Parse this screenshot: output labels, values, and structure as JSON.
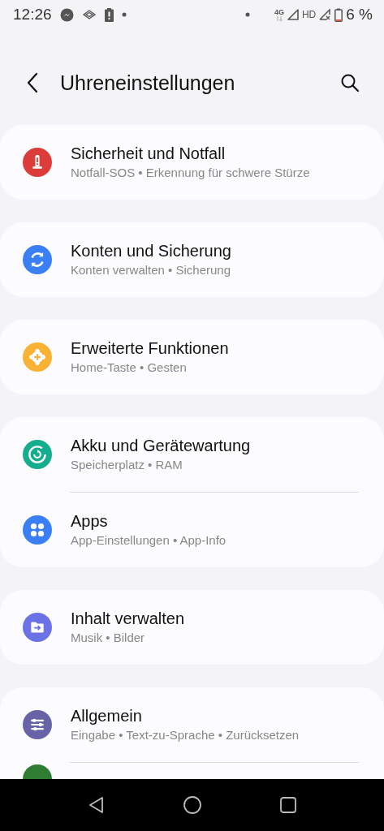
{
  "status_bar": {
    "time": "12:26",
    "network": "4G",
    "hd": "HD",
    "battery": "6 %"
  },
  "header": {
    "title": "Uhreneinstellungen"
  },
  "groups": [
    {
      "items": [
        {
          "title": "Sicherheit und Notfall",
          "subtitle": "Notfall-SOS • Erkennung für schwere Stürze",
          "kind": "warning",
          "color": "#dc3d3a"
        }
      ]
    },
    {
      "items": [
        {
          "title": "Konten und Sicherung",
          "subtitle": "Konten verwalten • Sicherung",
          "kind": "sync",
          "color": "#3b7ff5"
        }
      ]
    },
    {
      "items": [
        {
          "title": "Erweiterte Funktionen",
          "subtitle": "Home-Taste • Gesten",
          "kind": "plus",
          "color": "#f9b234"
        }
      ]
    },
    {
      "items": [
        {
          "title": "Akku und Gerätewartung",
          "subtitle": "Speicherplatz • RAM",
          "kind": "refresh",
          "color": "#16ad8f"
        },
        {
          "title": "Apps",
          "subtitle": "App-Einstellungen • App-Info",
          "kind": "apps",
          "color": "#3b7ff5"
        }
      ]
    },
    {
      "items": [
        {
          "title": "Inhalt verwalten",
          "subtitle": "Musik • Bilder",
          "kind": "folder",
          "color": "#6b72e6"
        }
      ]
    },
    {
      "items": [
        {
          "title": "Allgemein",
          "subtitle": "Eingabe • Text-zu-Sprache • Zurücksetzen",
          "kind": "sliders",
          "color": "#6763a6"
        },
        {
          "kind": "partial",
          "color": "#2e7d32"
        }
      ]
    }
  ]
}
